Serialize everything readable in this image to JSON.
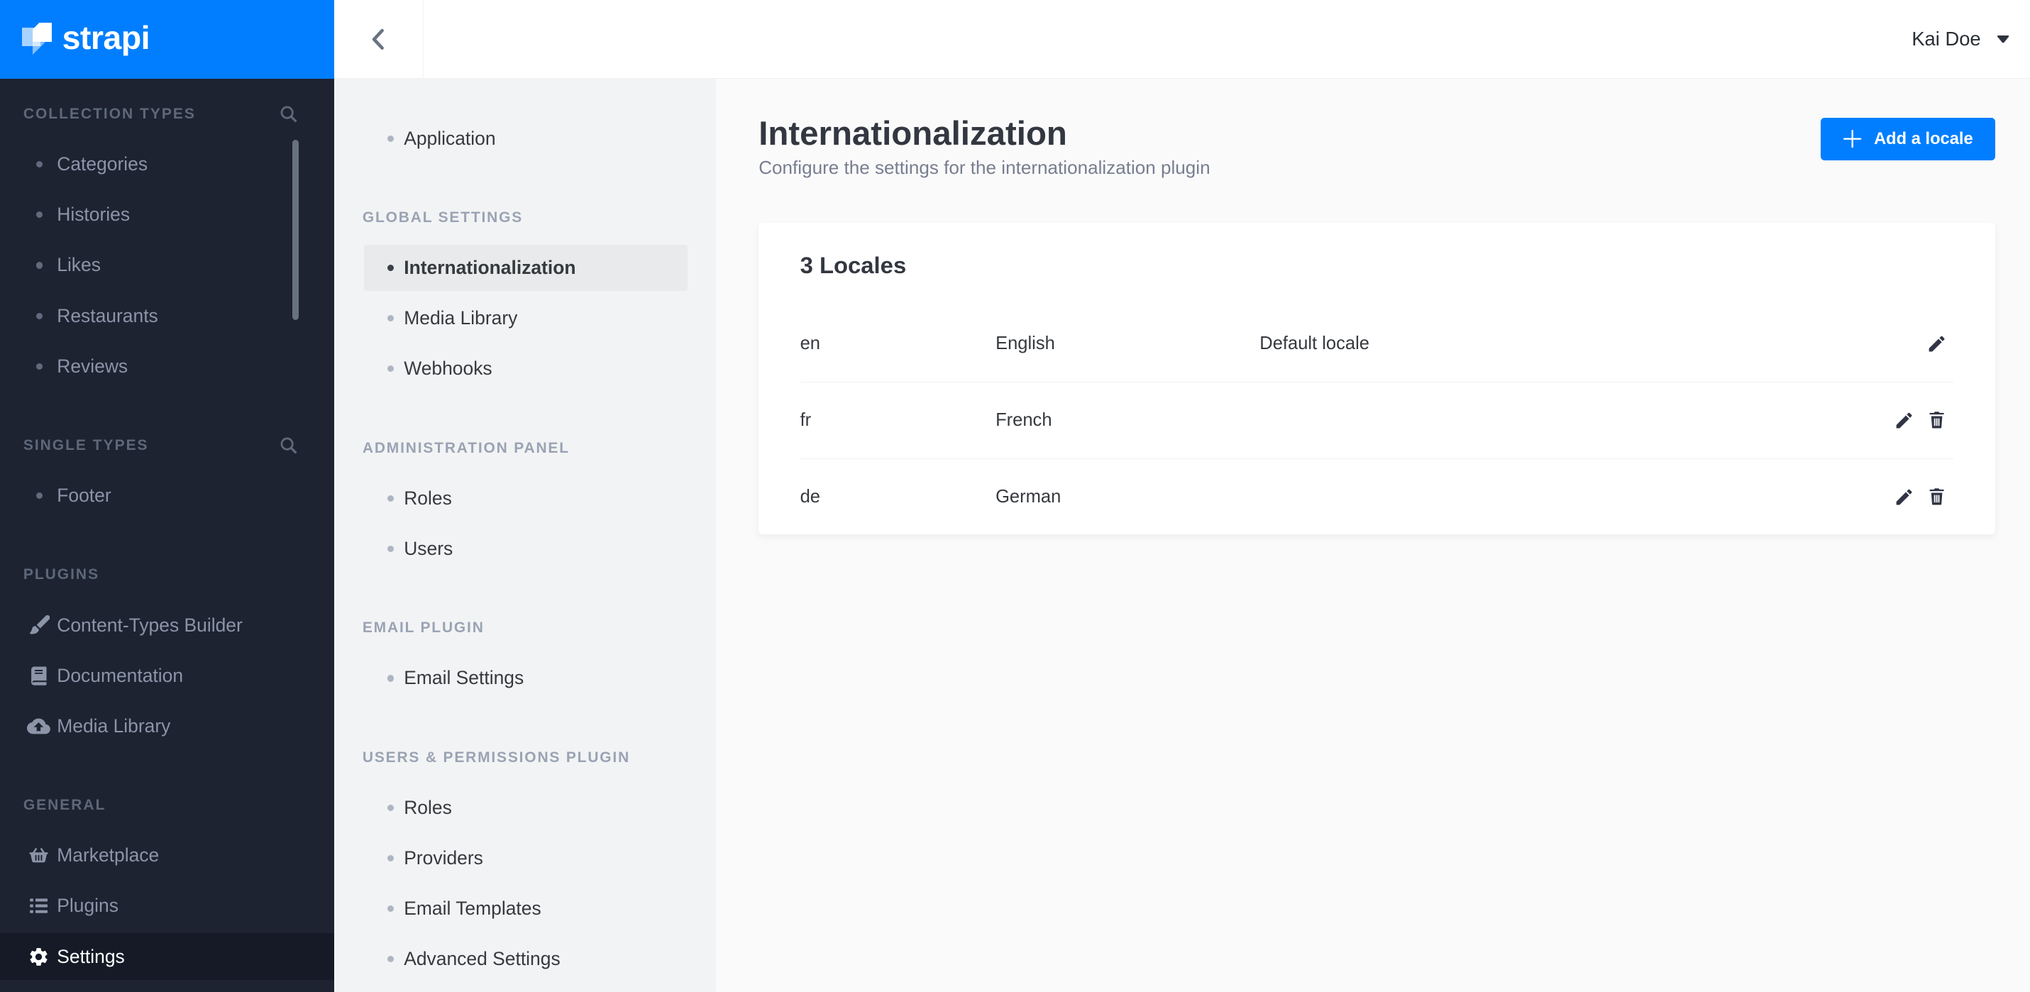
{
  "brand": {
    "name": "strapi",
    "color": "#007EFF"
  },
  "user": {
    "name": "Kai Doe"
  },
  "sidebar": {
    "sections": [
      {
        "label": "COLLECTION TYPES",
        "has_search": true,
        "items": [
          {
            "label": "Categories"
          },
          {
            "label": "Histories"
          },
          {
            "label": "Likes"
          },
          {
            "label": "Restaurants"
          },
          {
            "label": "Reviews"
          }
        ]
      },
      {
        "label": "SINGLE TYPES",
        "has_search": true,
        "items": [
          {
            "label": "Footer"
          }
        ]
      },
      {
        "label": "PLUGINS",
        "has_search": false,
        "items": [
          {
            "label": "Content-Types Builder",
            "icon": "brush"
          },
          {
            "label": "Documentation",
            "icon": "book"
          },
          {
            "label": "Media Library",
            "icon": "cloud-upload"
          }
        ]
      },
      {
        "label": "GENERAL",
        "has_search": false,
        "items": [
          {
            "label": "Marketplace",
            "icon": "basket"
          },
          {
            "label": "Plugins",
            "icon": "list"
          },
          {
            "label": "Settings",
            "icon": "gear",
            "active": true
          }
        ]
      }
    ]
  },
  "settings_menu": {
    "groups": [
      {
        "heading": "",
        "items": [
          {
            "label": "Application"
          }
        ]
      },
      {
        "heading": "GLOBAL SETTINGS",
        "items": [
          {
            "label": "Internationalization",
            "selected": true
          },
          {
            "label": "Media Library"
          },
          {
            "label": "Webhooks"
          }
        ]
      },
      {
        "heading": "ADMINISTRATION PANEL",
        "items": [
          {
            "label": "Roles"
          },
          {
            "label": "Users"
          }
        ]
      },
      {
        "heading": "EMAIL PLUGIN",
        "items": [
          {
            "label": "Email Settings"
          }
        ]
      },
      {
        "heading": "USERS & PERMISSIONS PLUGIN",
        "items": [
          {
            "label": "Roles"
          },
          {
            "label": "Providers"
          },
          {
            "label": "Email Templates"
          },
          {
            "label": "Advanced Settings"
          }
        ]
      }
    ]
  },
  "page": {
    "title": "Internationalization",
    "subtitle": "Configure the settings for the internationalization plugin",
    "add_button_label": "Add a locale"
  },
  "locales_card": {
    "title": "3 Locales",
    "rows": [
      {
        "code": "en",
        "name": "English",
        "status": "Default locale",
        "can_delete": false
      },
      {
        "code": "fr",
        "name": "French",
        "status": "",
        "can_delete": true
      },
      {
        "code": "de",
        "name": "German",
        "status": "",
        "can_delete": true
      }
    ]
  },
  "colors": {
    "accent": "#007EFF",
    "sidebar_bg": "#1D2331",
    "active_row_bg": "#151A26",
    "column_bg": "#F2F3F4",
    "selected_item_bg": "#E9EAEB",
    "main_bg": "#FAFAFB"
  }
}
